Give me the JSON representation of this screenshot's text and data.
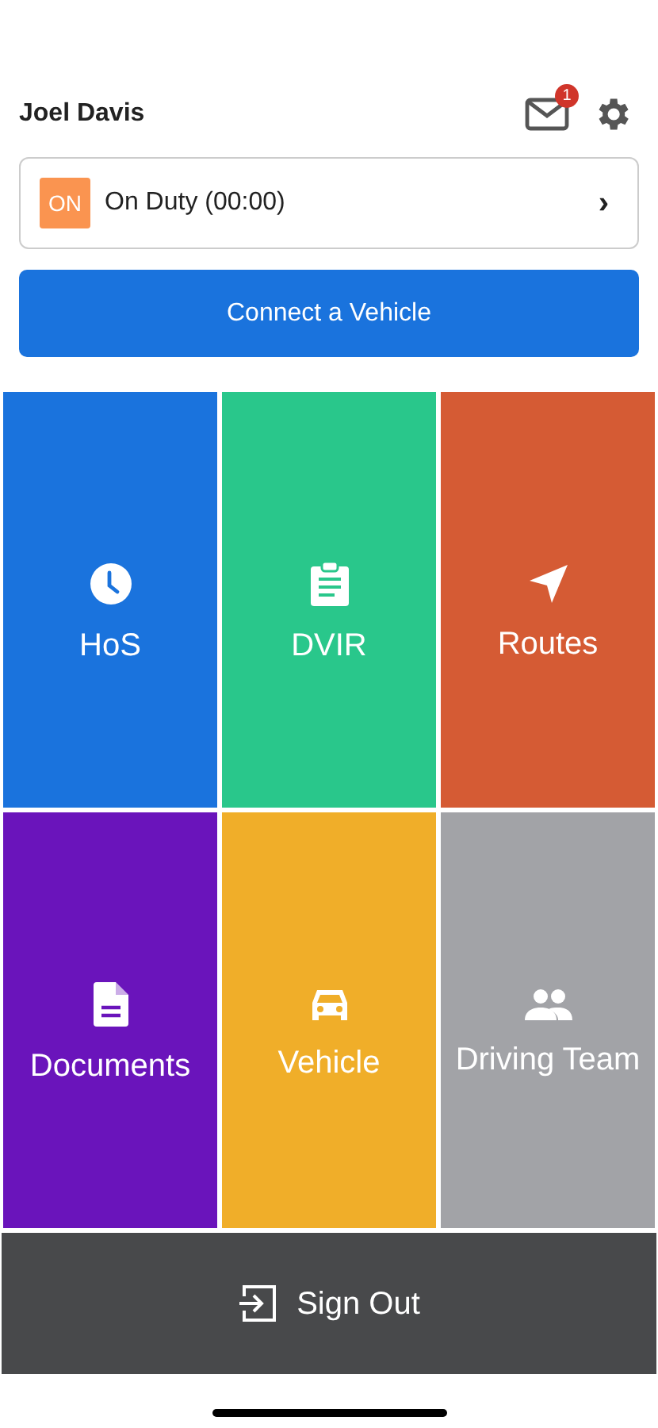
{
  "header": {
    "user_name": "Joel Davis",
    "unread_count": "1"
  },
  "duty_status": {
    "badge": "ON",
    "label": "On Duty (00:00)",
    "chevron": "›"
  },
  "connect_button": {
    "label": "Connect a Vehicle"
  },
  "tiles": [
    {
      "label": "HoS",
      "kind": "clock",
      "color": "#1a73dd"
    },
    {
      "label": "DVIR",
      "kind": "clipboard",
      "color": "#29c78b"
    },
    {
      "label": "Routes",
      "kind": "navigation",
      "color": "#d55b34"
    },
    {
      "label": "Documents",
      "kind": "document",
      "color": "#6a14bb"
    },
    {
      "label": "Vehicle",
      "kind": "car",
      "color": "#f0ae29"
    },
    {
      "label": "Driving Team",
      "kind": "people",
      "color": "#a2a3a7"
    }
  ],
  "sign_out": {
    "label": "Sign Out"
  }
}
